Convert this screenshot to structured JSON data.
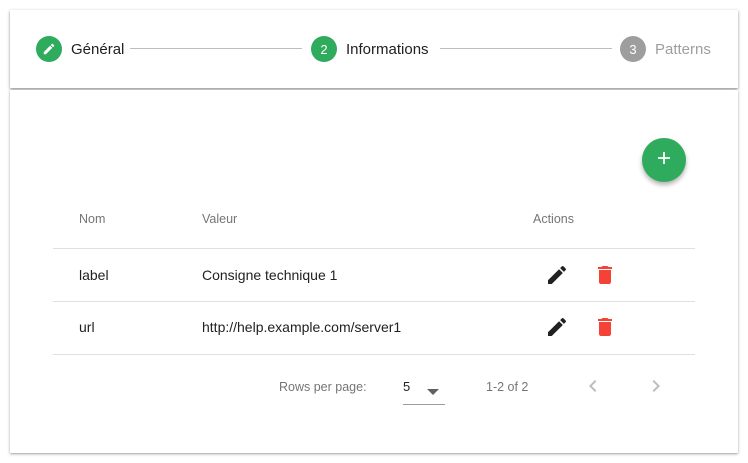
{
  "colors": {
    "accent": "#2eab5c",
    "inactive_step": "#9e9e9e",
    "delete": "#f44336",
    "edit": "#212121"
  },
  "stepper": {
    "steps": [
      {
        "number": "",
        "label": "Général",
        "state": "completed",
        "icon": "pencil-icon"
      },
      {
        "number": "2",
        "label": "Informations",
        "state": "active"
      },
      {
        "number": "3",
        "label": "Patterns",
        "state": "inactive"
      }
    ]
  },
  "add_button": {
    "icon": "plus-icon"
  },
  "table": {
    "columns": [
      "Nom",
      "Valeur",
      "Actions"
    ],
    "rows": [
      {
        "nom": "label",
        "valeur": "Consigne technique 1"
      },
      {
        "nom": "url",
        "valeur": "http://help.example.com/server1"
      }
    ],
    "row_actions": [
      "edit-icon",
      "delete-icon"
    ]
  },
  "pagination": {
    "rows_per_page_label": "Rows per page:",
    "rows_per_page_value": "5",
    "range_label": "1-2 of 2"
  }
}
